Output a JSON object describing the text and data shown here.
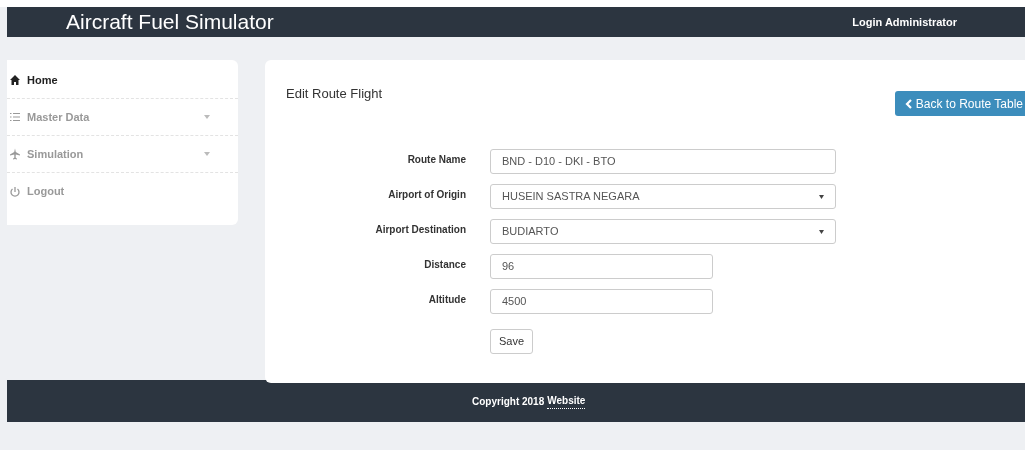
{
  "header": {
    "title": "Aircraft Fuel Simulator",
    "user": "Login Administrator"
  },
  "sidebar": {
    "items": [
      {
        "kind": "home",
        "label": "Home",
        "selected": true,
        "has_submenu": false
      },
      {
        "kind": "list",
        "label": "Master Data",
        "selected": false,
        "has_submenu": true
      },
      {
        "kind": "plane",
        "label": "Simulation",
        "selected": false,
        "has_submenu": true
      },
      {
        "kind": "power",
        "label": "Logout",
        "selected": false,
        "has_submenu": false
      }
    ]
  },
  "main": {
    "title": "Edit Route Flight",
    "back_button": "Back to Route Table",
    "fields": [
      {
        "kind": "text",
        "label": "Route Name",
        "value": "BND - D10 - DKI - BTO",
        "wide": true
      },
      {
        "kind": "select",
        "label": "Airport of Origin",
        "value": "HUSEIN SASTRA NEGARA",
        "wide": true
      },
      {
        "kind": "select",
        "label": "Airport Destination",
        "value": "BUDIARTO",
        "wide": true
      },
      {
        "kind": "text",
        "label": "Distance",
        "value": "96",
        "wide": false
      },
      {
        "kind": "text",
        "label": "Altitude",
        "value": "4500",
        "wide": false
      }
    ],
    "save_button": "Save"
  },
  "footer": {
    "copyright": "Copyright 2018",
    "link": "Website"
  }
}
